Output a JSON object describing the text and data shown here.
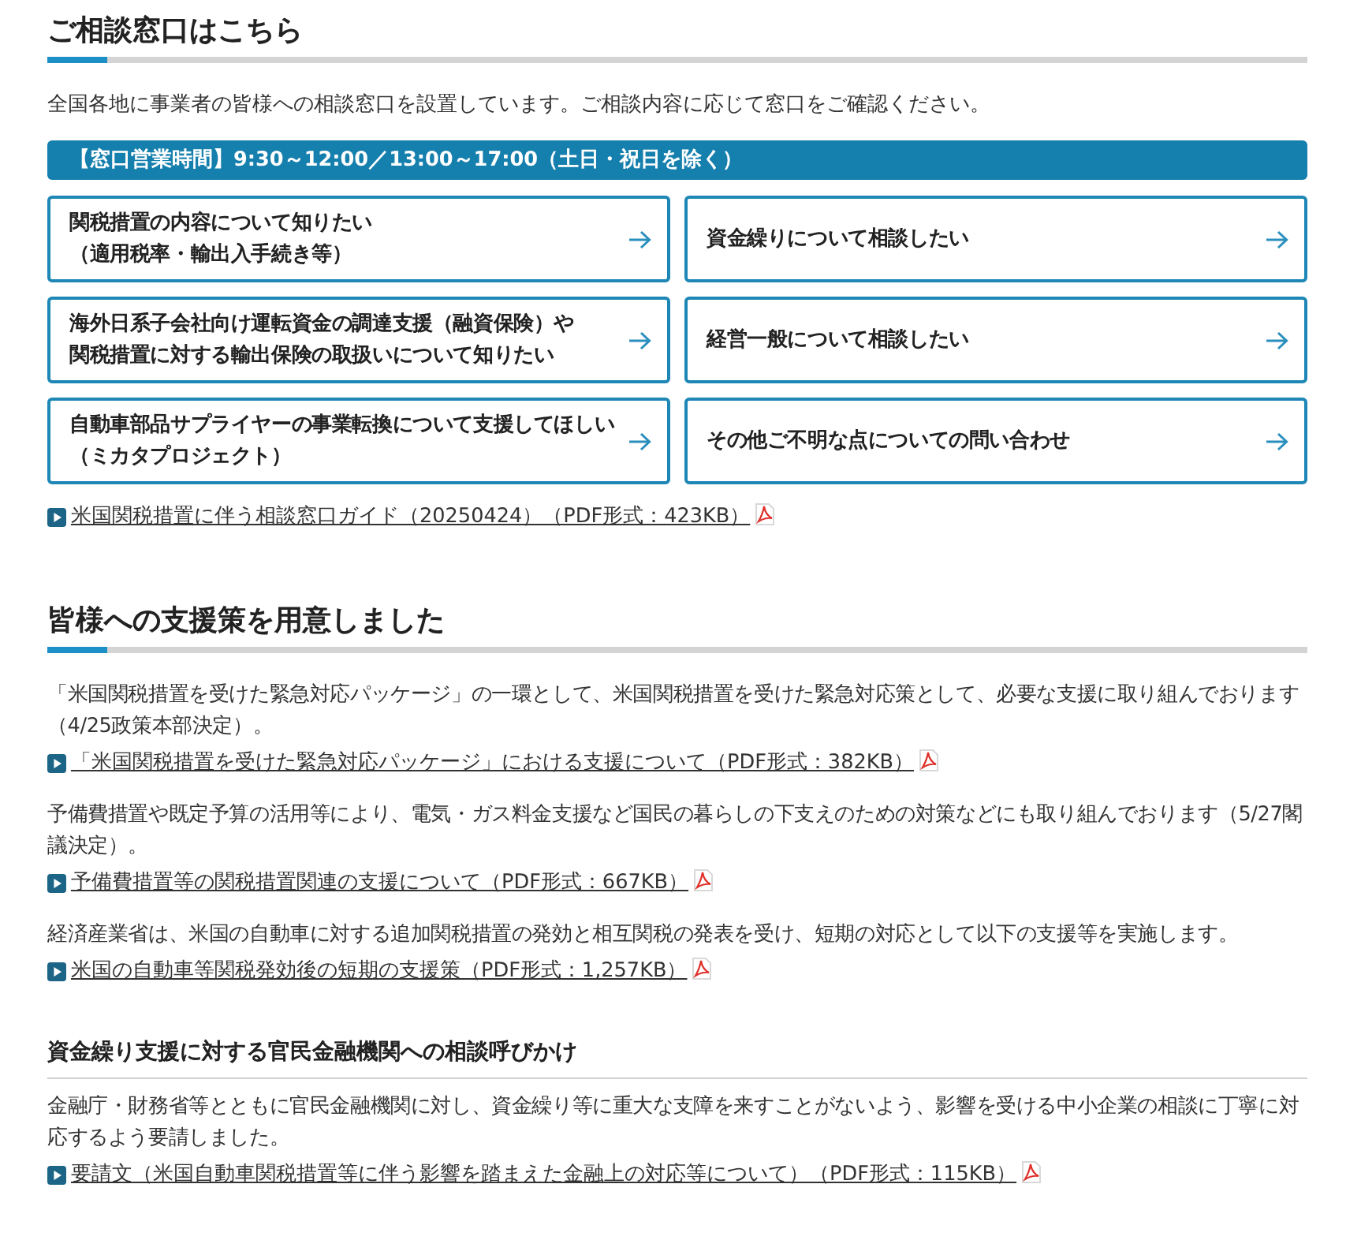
{
  "consultation": {
    "heading": "ご相談窓口はこちら",
    "intro": "全国各地に事業者の皆様への相談窓口を設置しています。ご相談内容に応じて窓口をご確認ください。",
    "hours_banner": "【窓口営業時間】9:30～12:00／13:00～17:00（土日・祝日を除く）",
    "cards": [
      {
        "lines": [
          "関税措置の内容について知りたい",
          "（適用税率・輸出入手続き等）"
        ]
      },
      {
        "lines": [
          "資金繰りについて相談したい"
        ]
      },
      {
        "lines": [
          "海外日系子会社向け運転資金の調達支援（融資保険）や",
          "関税措置に対する輸出保険の取扱いについて知りたい"
        ]
      },
      {
        "lines": [
          "経営一般について相談したい"
        ]
      },
      {
        "lines": [
          "自動車部品サプライヤーの事業転換について支援してほしい",
          "（ミカタプロジェクト）"
        ]
      },
      {
        "lines": [
          "その他ご不明な点についての問い合わせ"
        ]
      }
    ],
    "link": "米国関税措置に伴う相談窓口ガイド（20250424）（PDF形式：423KB）"
  },
  "support": {
    "heading": "皆様への支援策を用意しました",
    "items": [
      {
        "text": "「米国関税措置を受けた緊急対応パッケージ」の一環として、米国関税措置を受けた緊急対応策として、必要な支援に取り組んでおります（4/25政策本部決定）。",
        "link": "「米国関税措置を受けた緊急対応パッケージ」における支援について（PDF形式：382KB）"
      },
      {
        "text": "予備費措置や既定予算の活用等により、電気・ガス料金支援など国民の暮らしの下支えのための対策などにも取り組んでおります（5/27閣議決定）。",
        "link": "予備費措置等の関税措置関連の支援について（PDF形式：667KB）"
      },
      {
        "text": "経済産業省は、米国の自動車に対する追加関税措置の発効と相互関税の発表を受け、短期の対応として以下の支援等を実施します。",
        "link": "米国の自動車等関税発効後の短期の支援策（PDF形式：1,257KB）"
      }
    ],
    "subsection": {
      "heading": "資金繰り支援に対する官民金融機関への相談呼びかけ",
      "text": "金融庁・財務省等とともに官民金融機関に対し、資金繰り等に重大な支障を来すことがないよう、影響を受ける中小企業の相談に丁寧に対応するよう要請しました。",
      "link": "要請文（米国自動車関税措置等に伴う影響を踏まえた金融上の対応等について）（PDF形式：115KB）"
    }
  }
}
